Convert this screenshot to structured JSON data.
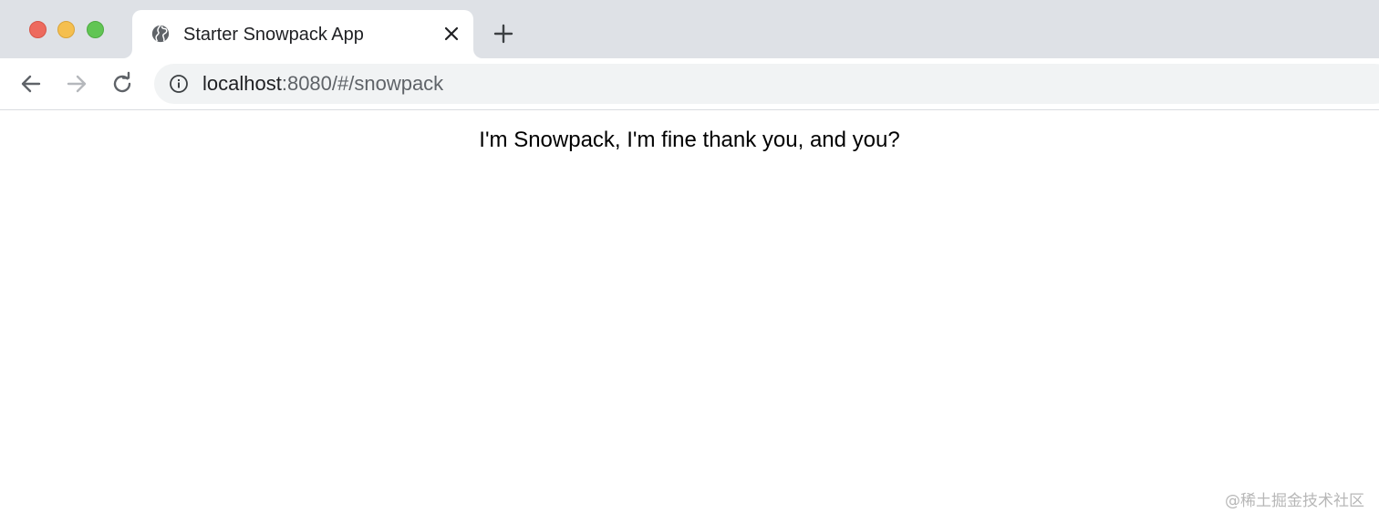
{
  "browser": {
    "tab": {
      "title": "Starter Snowpack App",
      "favicon": "globe-icon",
      "close_icon": "close-icon"
    },
    "new_tab_icon": "plus-icon",
    "nav": {
      "back_icon": "arrow-left-icon",
      "forward_icon": "arrow-right-icon",
      "reload_icon": "reload-icon"
    },
    "omnibox": {
      "info_icon": "info-icon",
      "url_host": "localhost",
      "url_rest": ":8080/#/snowpack"
    },
    "colors": {
      "tabstrip_bg": "#dee1e6",
      "omnibox_bg": "#f1f3f4",
      "traffic_red": "#ed6a5e",
      "traffic_yellow": "#f5bf4f",
      "traffic_green": "#61c554"
    }
  },
  "page": {
    "message": "I'm Snowpack, I'm fine thank you, and you?"
  },
  "watermark": "@稀土掘金技术社区"
}
